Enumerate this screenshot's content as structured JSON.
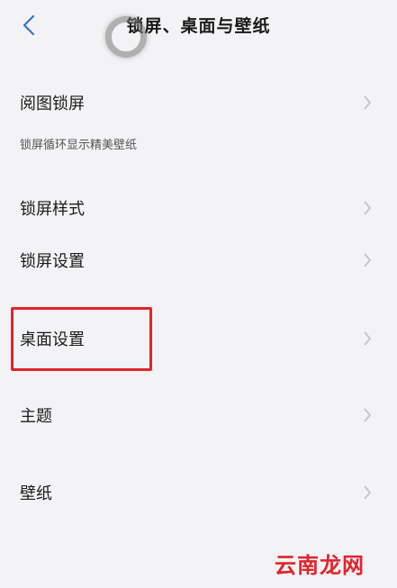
{
  "header": {
    "title": "锁屏、桌面与壁纸",
    "back_icon": "chevron-left-icon"
  },
  "items": [
    {
      "label": "阅图锁屏",
      "subtitle": "锁屏循环显示精美壁纸"
    },
    {
      "label": "锁屏样式"
    },
    {
      "label": "锁屏设置"
    },
    {
      "label": "桌面设置"
    },
    {
      "label": "主题"
    },
    {
      "label": "壁纸"
    }
  ],
  "watermark": "云南龙网",
  "colors": {
    "background": "#f3f3f5",
    "highlight": "#e0242d",
    "chevron": "#c4c4c8"
  }
}
